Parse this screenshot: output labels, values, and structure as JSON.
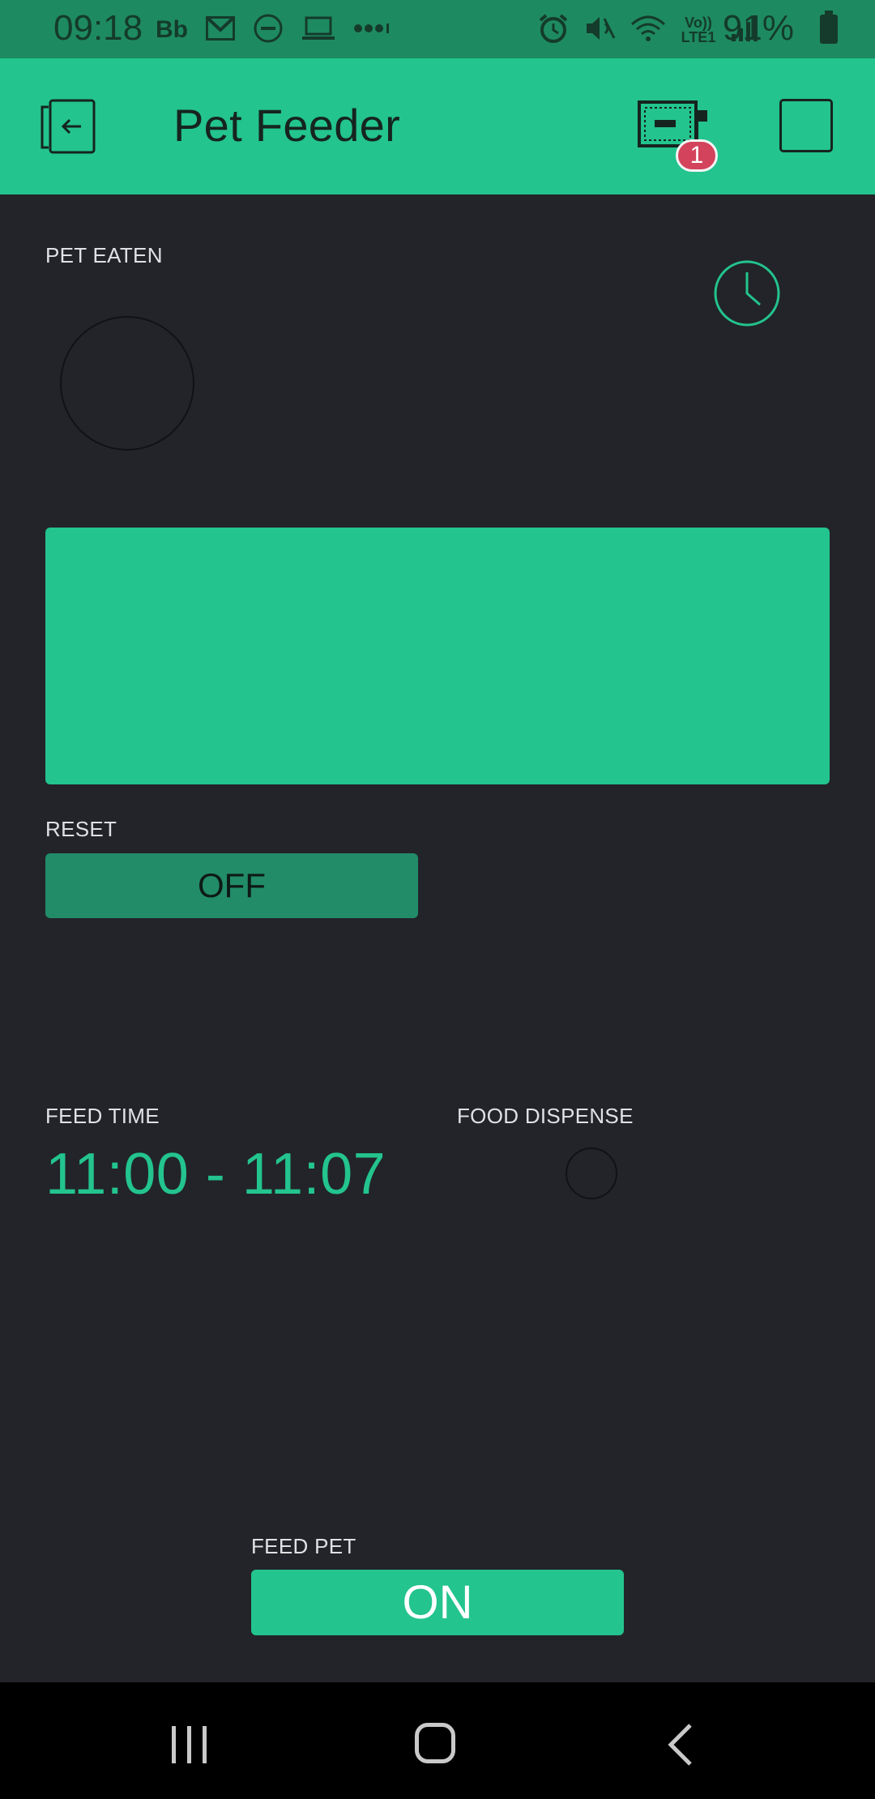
{
  "status_bar": {
    "time": "09:18",
    "carrier_label": "Bb",
    "network_label": "Vo)) LTE1",
    "battery_percent": "91%",
    "left_icons": [
      "gmail-icon",
      "do-not-disturb-icon",
      "laptop-icon",
      "more-dots-icon"
    ],
    "right_icons": [
      "alarm-icon",
      "mute-vibrate-icon",
      "wifi-icon",
      "signal-icon",
      "battery-icon"
    ]
  },
  "app_bar": {
    "title": "Pet Feeder",
    "device_badge_count": "1"
  },
  "widgets": {
    "pet_eaten_label": "PET EATEN",
    "reset_label": "RESET",
    "reset_button_text": "OFF",
    "feed_time_label": "FEED TIME",
    "feed_time_value": "11:00 - 11:07",
    "food_dispense_label": "FOOD DISPENSE",
    "feed_pet_label": "FEED PET",
    "feed_pet_button_text": "ON"
  },
  "colors": {
    "accent": "#23c48e",
    "background": "#222429",
    "status_bar": "#1e8a62",
    "badge": "#d3435c",
    "off_button": "#228c69"
  }
}
